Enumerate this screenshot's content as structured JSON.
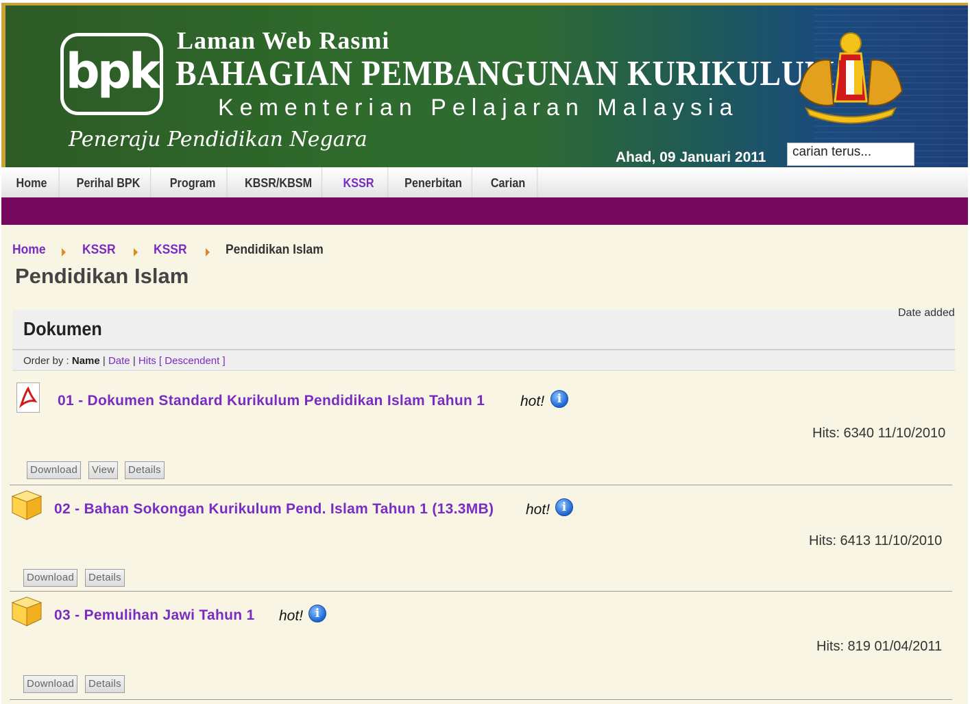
{
  "header": {
    "pre_title": "Laman Web Rasmi",
    "title": "BAHAGIAN PEMBANGUNAN KURIKULUM",
    "subtitle": "Kementerian Pelajaran Malaysia",
    "slogan": "Peneraju Pendidikan Negara",
    "logo_text": "bpk",
    "date": "Ahad, 09 Januari 2011",
    "search_value": "carian terus..."
  },
  "nav": {
    "items": [
      {
        "label": "Home"
      },
      {
        "label": "Perihal BPK"
      },
      {
        "label": "Program"
      },
      {
        "label": "KBSR/KBSM"
      },
      {
        "label": "KSSR"
      },
      {
        "label": "Penerbitan"
      },
      {
        "label": "Carian"
      }
    ],
    "active": "KSSR"
  },
  "breadcrumb": [
    "Home",
    "KSSR",
    "KSSR",
    "Pendidikan Islam"
  ],
  "page_title": "Pendidikan Islam",
  "category": {
    "title": "Dokumen",
    "date_added_label": "Date added",
    "order_by_label": "Order by :",
    "order_name": "Name",
    "order_date": "Date",
    "order_hits": "Hits",
    "order_dir": "[ Descendent ]"
  },
  "documents": [
    {
      "title": "01 - Dokumen Standard Kurikulum Pendidikan Islam Tahun 1",
      "hot": "hot!",
      "hits": "Hits: 6340",
      "date": "11/10/2010",
      "icon": "pdf-icon",
      "buttons": [
        "Download",
        "View",
        "Details"
      ]
    },
    {
      "title": "02 - Bahan Sokongan Kurikulum Pend. Islam Tahun 1 (13.3MB)",
      "hot": "hot!",
      "hits": "Hits: 6413",
      "date": "11/10/2010",
      "icon": "package-icon",
      "buttons": [
        "Download",
        "Details"
      ]
    },
    {
      "title": "03 - Pemulihan Jawi Tahun 1",
      "hot": "hot!",
      "hits": "Hits: 819",
      "date": "01/04/2011",
      "icon": "package-icon",
      "buttons": [
        "Download",
        "Details"
      ]
    }
  ],
  "colors": {
    "link": "#7a2bc2",
    "purple_bar": "#76095e",
    "content_bg": "#f8f5e4",
    "breadcrumb_arrow": "#e08a1e"
  }
}
